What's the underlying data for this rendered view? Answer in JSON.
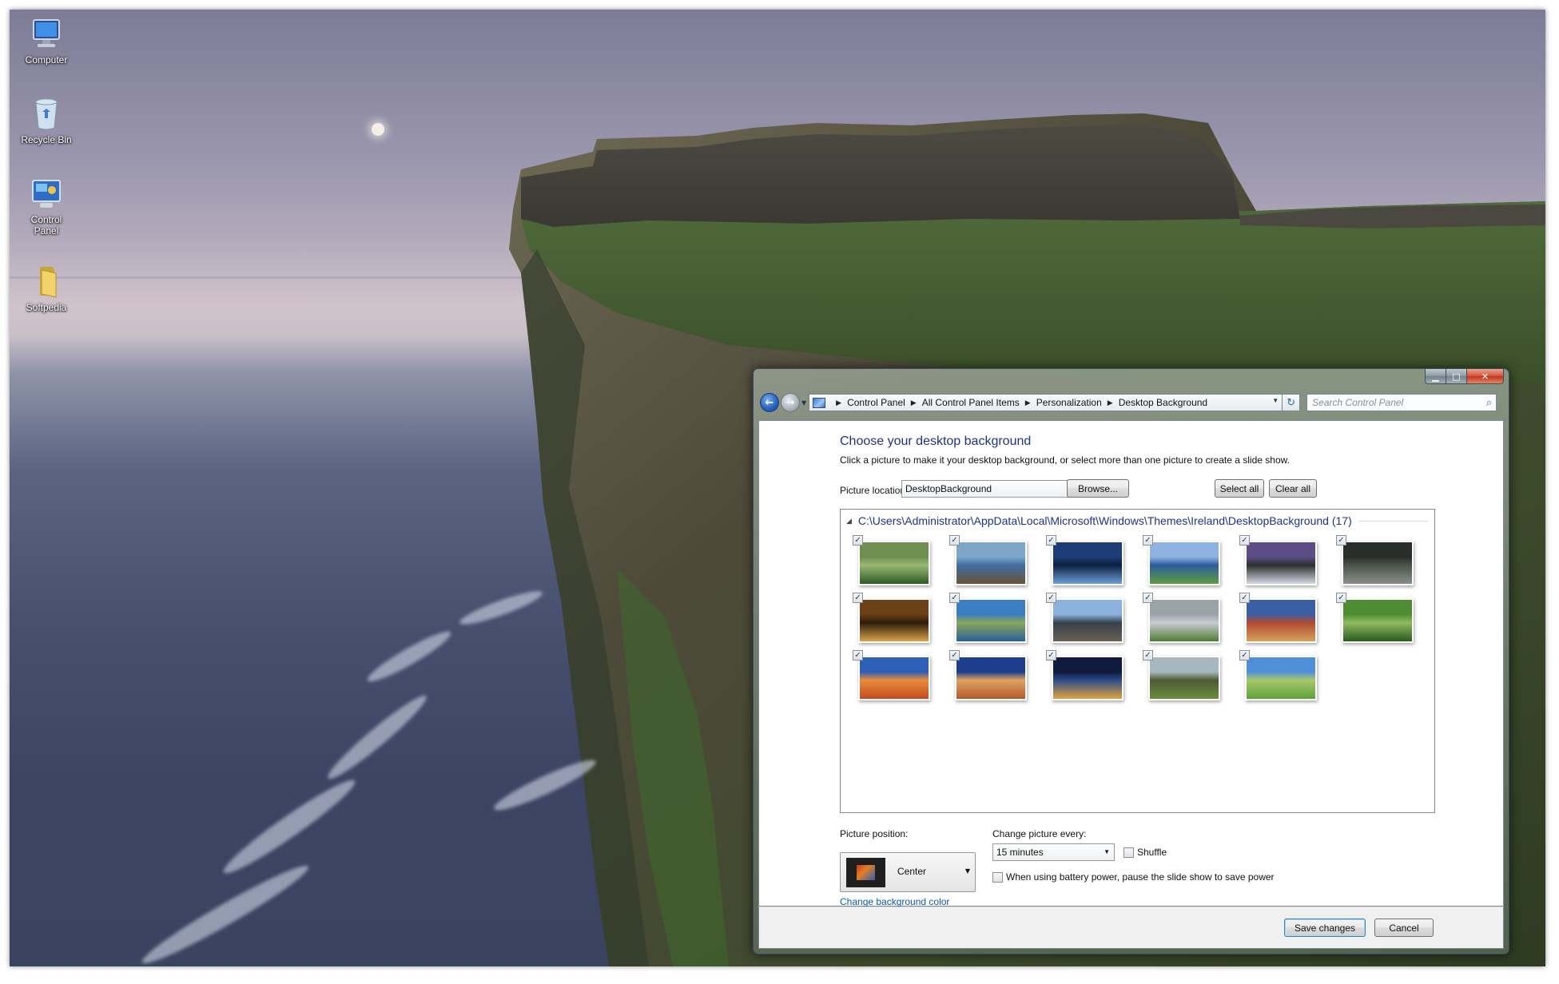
{
  "desktop": {
    "icons": [
      {
        "label": "Computer"
      },
      {
        "label": "Recycle Bin"
      },
      {
        "label": "Control Panel"
      },
      {
        "label": "Softpedia"
      }
    ]
  },
  "window": {
    "controls": {
      "minimize": "▁",
      "maximize": "□",
      "close": "✕"
    },
    "breadcrumb": [
      "Control Panel",
      "All Control Panel Items",
      "Personalization",
      "Desktop Background"
    ],
    "search_placeholder": "Search Control Panel",
    "heading": "Choose your desktop background",
    "subtitle": "Click a picture to make it your desktop background, or select more than one picture to create a slide show.",
    "picture_location_label": "Picture location:",
    "picture_location_value": "DesktopBackground",
    "browse_label": "Browse...",
    "select_all_label": "Select all",
    "clear_all_label": "Clear all",
    "gallery_path": "C:\\Users\\Administrator\\AppData\\Local\\Microsoft\\Windows\\Themes\\Ireland\\DesktopBackground (17)",
    "thumbnails": [
      {
        "checked": true,
        "colors": [
          "#6f8e52",
          "#2f5a24",
          "#98b873"
        ]
      },
      {
        "checked": true,
        "colors": [
          "#7da6c9",
          "#6c5237",
          "#3f6ea0"
        ]
      },
      {
        "checked": true,
        "colors": [
          "#1c3d78",
          "#6d9fd8",
          "#0b1f3f"
        ]
      },
      {
        "checked": true,
        "colors": [
          "#8fb3e0",
          "#5f9c3f",
          "#2c5c9f"
        ]
      },
      {
        "checked": true,
        "colors": [
          "#5c4d86",
          "#d7d9e2",
          "#2b2f2c"
        ]
      },
      {
        "checked": true,
        "colors": [
          "#2a2e2b",
          "#8a908a",
          "#4a544a"
        ]
      },
      {
        "checked": true,
        "colors": [
          "#6b3f17",
          "#d9a44c",
          "#2d1b0b"
        ]
      },
      {
        "checked": true,
        "colors": [
          "#3c7ec4",
          "#2a5f9c",
          "#88a858"
        ]
      },
      {
        "checked": true,
        "colors": [
          "#8cb1dc",
          "#6b6154",
          "#36414c"
        ]
      },
      {
        "checked": true,
        "colors": [
          "#9aa3a8",
          "#4f7a36",
          "#c7cdd1"
        ]
      },
      {
        "checked": true,
        "colors": [
          "#3b5fa4",
          "#d6a35a",
          "#b14a33"
        ]
      },
      {
        "checked": true,
        "colors": [
          "#4e8c33",
          "#2b5a1d",
          "#8fbb61"
        ]
      },
      {
        "checked": true,
        "colors": [
          "#2d5fb7",
          "#c24a22",
          "#e98c3b"
        ]
      },
      {
        "checked": true,
        "colors": [
          "#1d3e8c",
          "#b05a2a",
          "#e0a260"
        ]
      },
      {
        "checked": true,
        "colors": [
          "#101a3c",
          "#e2a33f",
          "#2b4c8a"
        ]
      },
      {
        "checked": true,
        "colors": [
          "#a7b7c0",
          "#6b8d3e",
          "#4c5b32"
        ]
      },
      {
        "checked": true,
        "colors": [
          "#4f8fd8",
          "#5da03a",
          "#a7c96a"
        ]
      }
    ],
    "picture_position_label": "Picture position:",
    "picture_position_value": "Center",
    "change_every_label": "Change picture every:",
    "change_every_value": "15 minutes",
    "shuffle_label": "Shuffle",
    "battery_label": "When using battery power, pause the slide show to save power",
    "change_bg_color_link": "Change background color",
    "save_label": "Save changes",
    "cancel_label": "Cancel"
  }
}
